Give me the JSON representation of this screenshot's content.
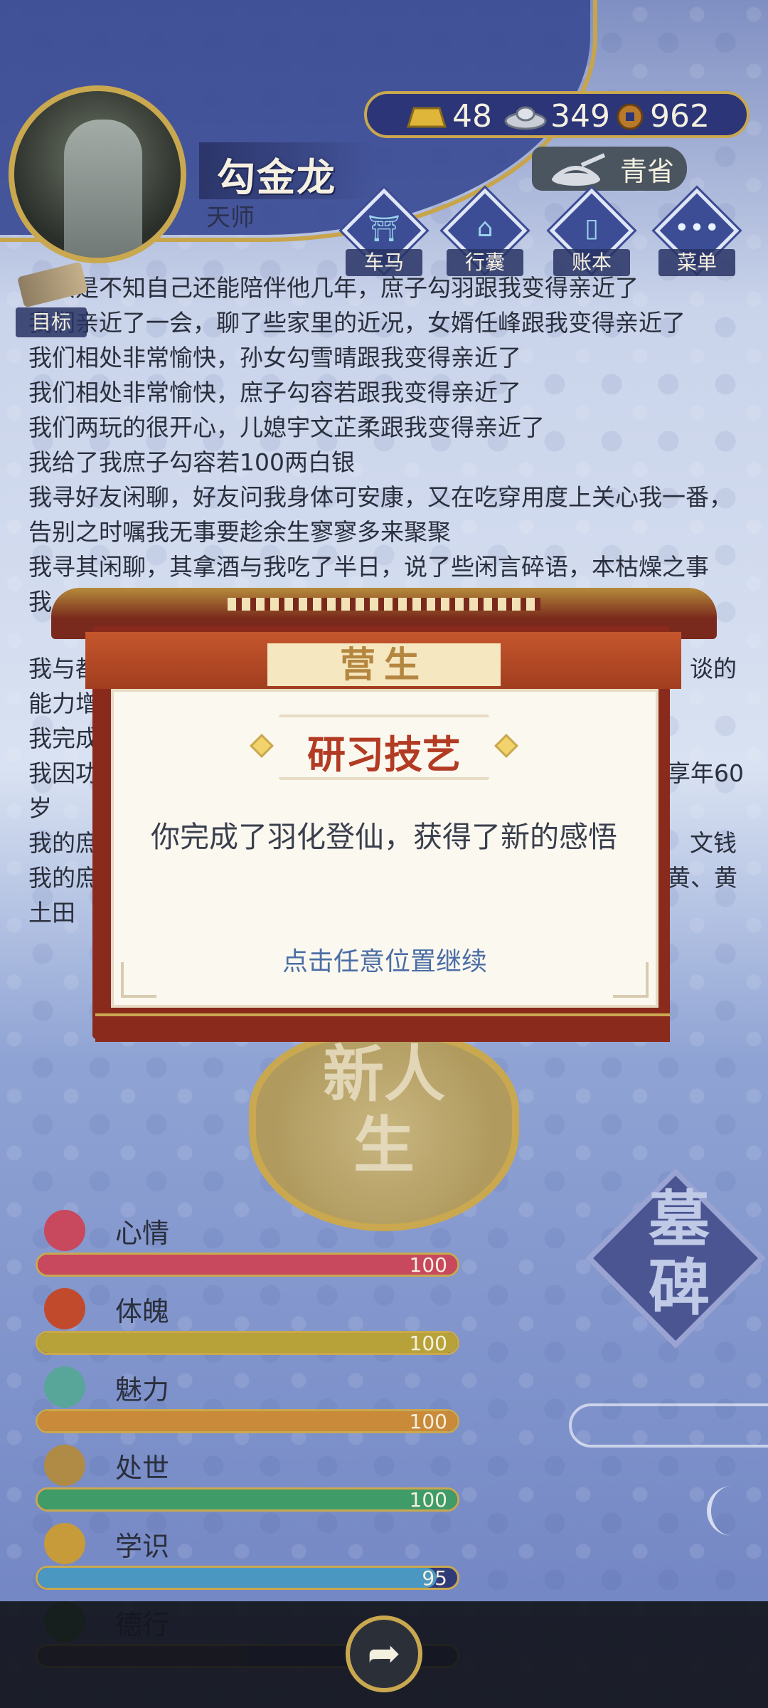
{
  "player": {
    "name": "勾金龙",
    "title": "天师"
  },
  "currency": {
    "gold": "48",
    "silver": "349",
    "coin": "962"
  },
  "province": "青省",
  "menu": [
    {
      "label": "车马",
      "icon": "carriage-icon"
    },
    {
      "label": "行囊",
      "icon": "bag-icon"
    },
    {
      "label": "账本",
      "icon": "ledger-icon"
    },
    {
      "label": "菜单",
      "icon": "more-icon"
    }
  ],
  "goal_label": "目标",
  "log": [
    "我只是不知自己还能陪伴他几年，庶子勾羽跟我变得亲近了",
    "我们亲近了一会，聊了些家里的近况，女婿任峰跟我变得亲近了",
    "我们相处非常愉快，孙女勾雪晴跟我变得亲近了",
    "我们相处非常愉快，庶子勾容若跟我变得亲近了",
    "我们两玩的很开心，儿媳宇文芷柔跟我变得亲近了",
    "我给了我庶子勾容若100两白银",
    "我寻好友闲聊，好友问我身体可安康，又在吃穿用度上关心我一番，告别之时嘱我无事要趁余生寥寥多来聚聚",
    "我寻其闲聊，其拿酒与我吃了半日，说了些闲言碎语，本枯燥之事",
    "我"
  ],
  "log_partial": {
    "line_right_1": "谈的",
    "line_left_1": "能力增",
    "line_left_2": "我完成",
    "line_left_3": "我因功",
    "line_right_3": "享年60",
    "line_left_4": "岁",
    "line_left_5": "我的庶",
    "line_right_5": "文钱",
    "line_left_6": "我的庶",
    "line_right_6": "黄、黄",
    "line_left_7": "土田",
    "line_left_0": "我与都"
  },
  "modal": {
    "header": "营生",
    "title": "研习技艺",
    "message": "你完成了羽化登仙，获得了新的感悟",
    "continue": "点击任意位置继续"
  },
  "emblem_text": "新人生",
  "tomb_text": "墓碑",
  "stats": [
    {
      "label": "心情",
      "value": "100",
      "level": 1.0,
      "color": "#c8485e",
      "icon": "flower-icon",
      "icon_color": "#c8485e"
    },
    {
      "label": "体魄",
      "value": "100",
      "level": 1.0,
      "color": "#b7a23a",
      "icon": "fire-hydrant-icon",
      "icon_color": "#c24a2c"
    },
    {
      "label": "魅力",
      "value": "100",
      "level": 1.0,
      "color": "#c98a3a",
      "icon": "jade-icon",
      "icon_color": "#58a59a"
    },
    {
      "label": "处世",
      "value": "100",
      "level": 1.0,
      "color": "#3f9b68",
      "icon": "sandals-icon",
      "icon_color": "#b08b45"
    },
    {
      "label": "学识",
      "value": "95",
      "level": 0.95,
      "color": "#4a97c2",
      "icon": "book-bundle-icon",
      "icon_color": "#c79a3a"
    },
    {
      "label": "德行",
      "value": "",
      "level": 0.5,
      "color": "#4a3560",
      "icon": "gourd-icon",
      "icon_color": "#3f7a3a"
    }
  ]
}
